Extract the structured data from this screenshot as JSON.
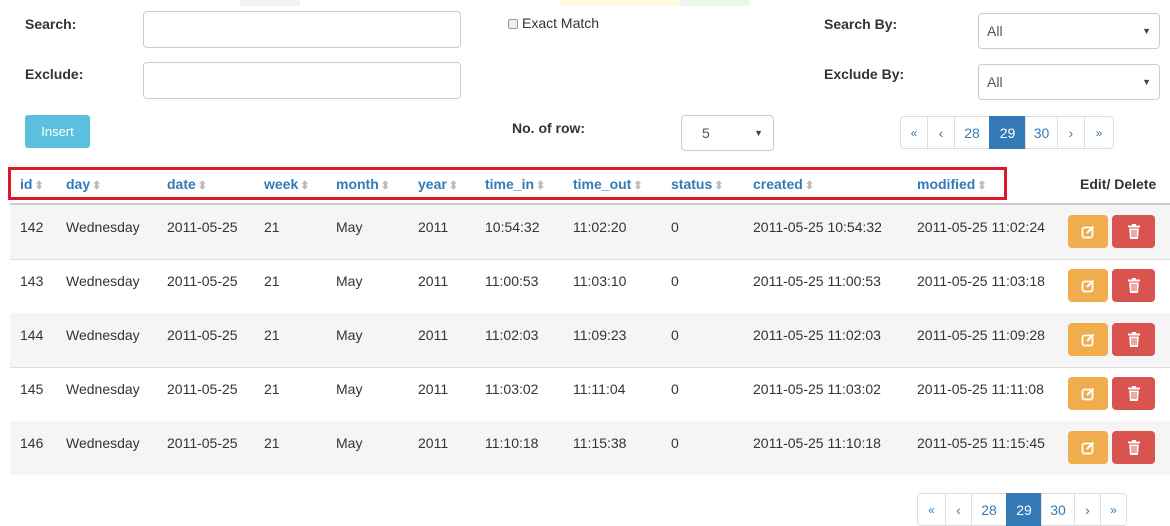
{
  "filters": {
    "search_label": "Search:",
    "search_value": "",
    "exact_match_label": "Exact Match",
    "search_by_label": "Search By:",
    "search_by_value": "All",
    "exclude_label": "Exclude:",
    "exclude_value": "",
    "exclude_by_label": "Exclude By:",
    "exclude_by_value": "All",
    "insert_label": "Insert",
    "rows_label": "No. of row:",
    "rows_value": "5"
  },
  "pagination": {
    "first": "«",
    "prev": "‹",
    "pages": [
      "28",
      "29",
      "30"
    ],
    "active_page": "29",
    "next": "›",
    "last": "»"
  },
  "table": {
    "columns": [
      "id",
      "day",
      "date",
      "week",
      "month",
      "year",
      "time_in",
      "time_out",
      "status",
      "created",
      "modified"
    ],
    "actions_header": "Edit/ Delete",
    "rows": [
      [
        "142",
        "Wednesday",
        "2011-05-25",
        "21",
        "May",
        "2011",
        "10:54:32",
        "11:02:20",
        "0",
        "2011-05-25 10:54:32",
        "2011-05-25 11:02:24"
      ],
      [
        "143",
        "Wednesday",
        "2011-05-25",
        "21",
        "May",
        "2011",
        "11:00:53",
        "11:03:10",
        "0",
        "2011-05-25 11:00:53",
        "2011-05-25 11:03:18"
      ],
      [
        "144",
        "Wednesday",
        "2011-05-25",
        "21",
        "May",
        "2011",
        "11:02:03",
        "11:09:23",
        "0",
        "2011-05-25 11:02:03",
        "2011-05-25 11:09:28"
      ],
      [
        "145",
        "Wednesday",
        "2011-05-25",
        "21",
        "May",
        "2011",
        "11:03:02",
        "11:11:04",
        "0",
        "2011-05-25 11:03:02",
        "2011-05-25 11:11:08"
      ],
      [
        "146",
        "Wednesday",
        "2011-05-25",
        "21",
        "May",
        "2011",
        "11:10:18",
        "11:15:38",
        "0",
        "2011-05-25 11:10:18",
        "2011-05-25 11:15:45"
      ]
    ]
  },
  "colors": {
    "header_text": "#337ab7",
    "highlight_box": "#e0162b",
    "edit_button": "#f0ad4e",
    "delete_button": "#d9534f",
    "insert_button": "#5bc0de"
  },
  "icons": {
    "sort": "sort-icon",
    "edit": "edit-icon",
    "delete": "trash-icon",
    "dropdown": "chevron-down-icon"
  }
}
